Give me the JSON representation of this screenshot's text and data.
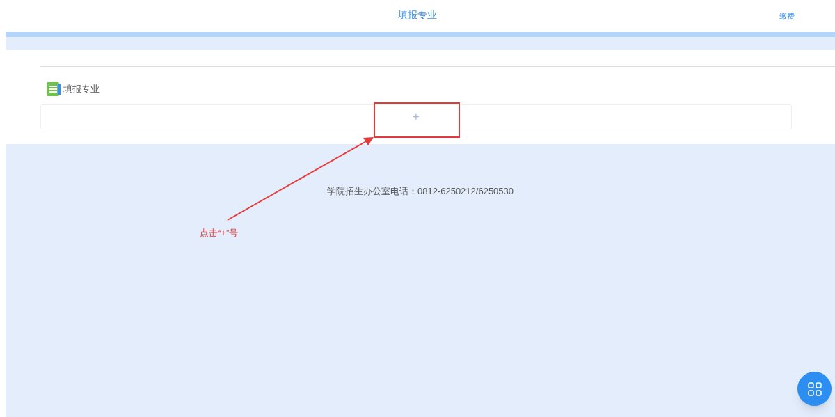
{
  "header": {
    "title": "填报专业",
    "link": "缴费"
  },
  "section": {
    "title": "填报专业",
    "add_button": "+"
  },
  "footer": {
    "contact": "学院招生办公室电话：0812-6250212/6250530"
  },
  "annotation": {
    "note": "点击“+”号"
  }
}
